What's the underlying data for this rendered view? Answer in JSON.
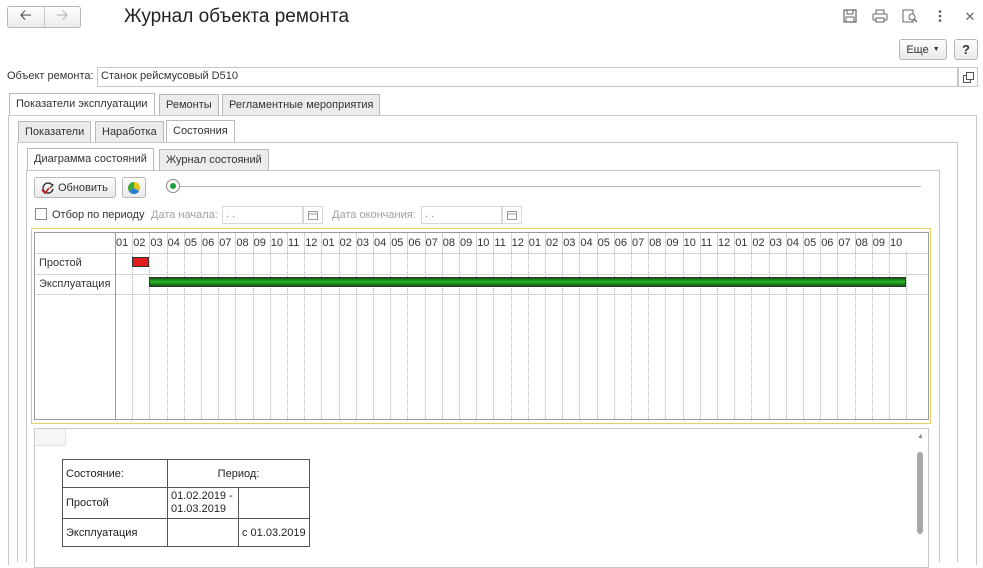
{
  "window": {
    "title": "Журнал объекта ремонта",
    "more_button": "Еще",
    "help_button": "?"
  },
  "object_field": {
    "label": "Объект ремонта:",
    "value": "Станок рейсмусовый D510"
  },
  "tabs_level1": [
    "Показатели эксплуатации",
    "Ремонты",
    "Регламентные мероприятия"
  ],
  "tabs_level2": [
    "Показатели",
    "Наработка",
    "Состояния"
  ],
  "tabs_level3": [
    "Диаграмма состояний",
    "Журнал состояний"
  ],
  "toolbar": {
    "refresh_label": "Обновить"
  },
  "filter": {
    "checkbox_label": "Отбор по периоду",
    "start_label": "Дата начала:",
    "start_placeholder": " .  .",
    "end_label": "Дата окончания:",
    "end_placeholder": " .  ."
  },
  "gantt": {
    "months": [
      "01",
      "02",
      "03",
      "04",
      "05",
      "06",
      "07",
      "08",
      "09",
      "10",
      "11",
      "12",
      "01",
      "02",
      "03",
      "04",
      "05",
      "06",
      "07",
      "08",
      "09",
      "10",
      "11",
      "12",
      "01",
      "02",
      "03",
      "04",
      "05",
      "06",
      "07",
      "08",
      "09",
      "10",
      "11",
      "12",
      "01",
      "02",
      "03",
      "04",
      "05",
      "06",
      "07",
      "08",
      "09",
      "10"
    ],
    "rows": [
      {
        "name": "Простой",
        "color": "#e21b1b",
        "start_index": 1,
        "end_index": 2
      },
      {
        "name": "Эксплуатация",
        "color": "#1f9c1f",
        "start_index": 2,
        "end_index": 46
      }
    ]
  },
  "legend": {
    "col_state": "Состояние:",
    "col_period": "Период:",
    "rows": [
      {
        "state": "Простой",
        "from": "01.02.2019 -",
        "to": "01.03.2019",
        "open": ""
      },
      {
        "state": "Эксплуатация",
        "from": "",
        "to": "",
        "open": "с 01.03.2019"
      }
    ]
  },
  "icons": {
    "back": "arrow-left-icon",
    "forward": "arrow-right-icon",
    "save": "floppy-icon",
    "print": "printer-icon",
    "preview": "print-preview-icon",
    "menu": "vertical-dots-icon",
    "close": "close-icon",
    "open": "open-window-icon",
    "refresh": "refresh-icon",
    "palette": "palette-icon",
    "calendar": "calendar-icon"
  }
}
